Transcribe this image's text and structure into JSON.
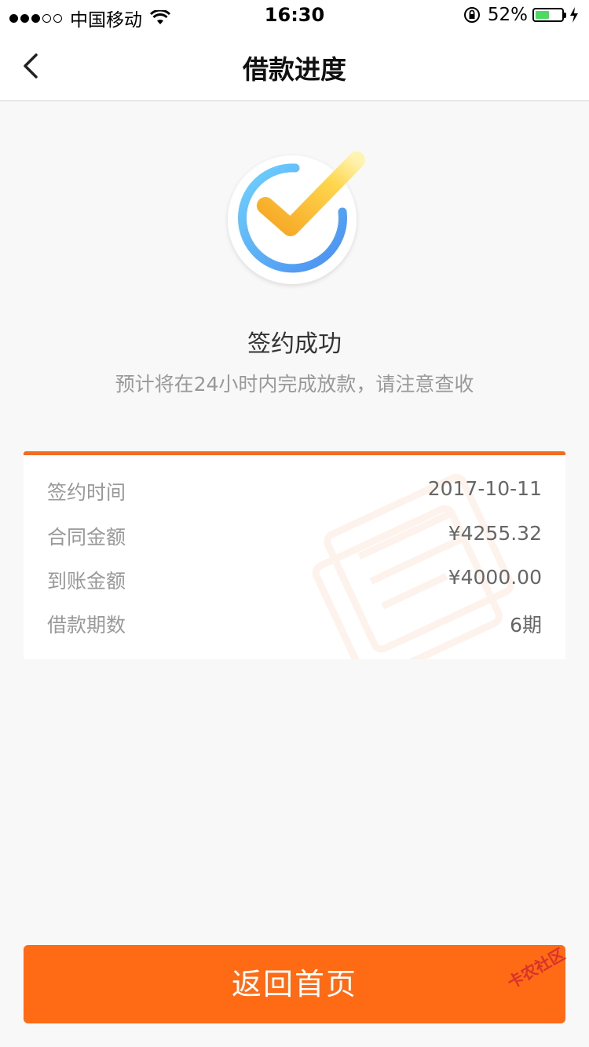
{
  "status_bar": {
    "carrier": "中国移动",
    "time": "16:30",
    "battery": "52%",
    "battery_level": 0.52,
    "signal_bars": 3,
    "signal_total": 5
  },
  "nav": {
    "title": "借款进度",
    "back_icon": "chevron-left-icon"
  },
  "success": {
    "icon": "check-circle-icon",
    "title": "签约成功",
    "subtitle": "预计将在24小时内完成放款，请注意查收"
  },
  "details": {
    "accent_color": "#f26d21",
    "rows": [
      {
        "label": "签约时间",
        "value": "2017-10-11"
      },
      {
        "label": "合同金额",
        "value": "¥4255.32"
      },
      {
        "label": "到账金额",
        "value": "¥4000.00"
      },
      {
        "label": "借款期数",
        "value": "6期"
      }
    ]
  },
  "actions": {
    "home_label": "返回首页",
    "button_color": "#ff6a14"
  },
  "watermark": {
    "text": "卡农社区"
  }
}
